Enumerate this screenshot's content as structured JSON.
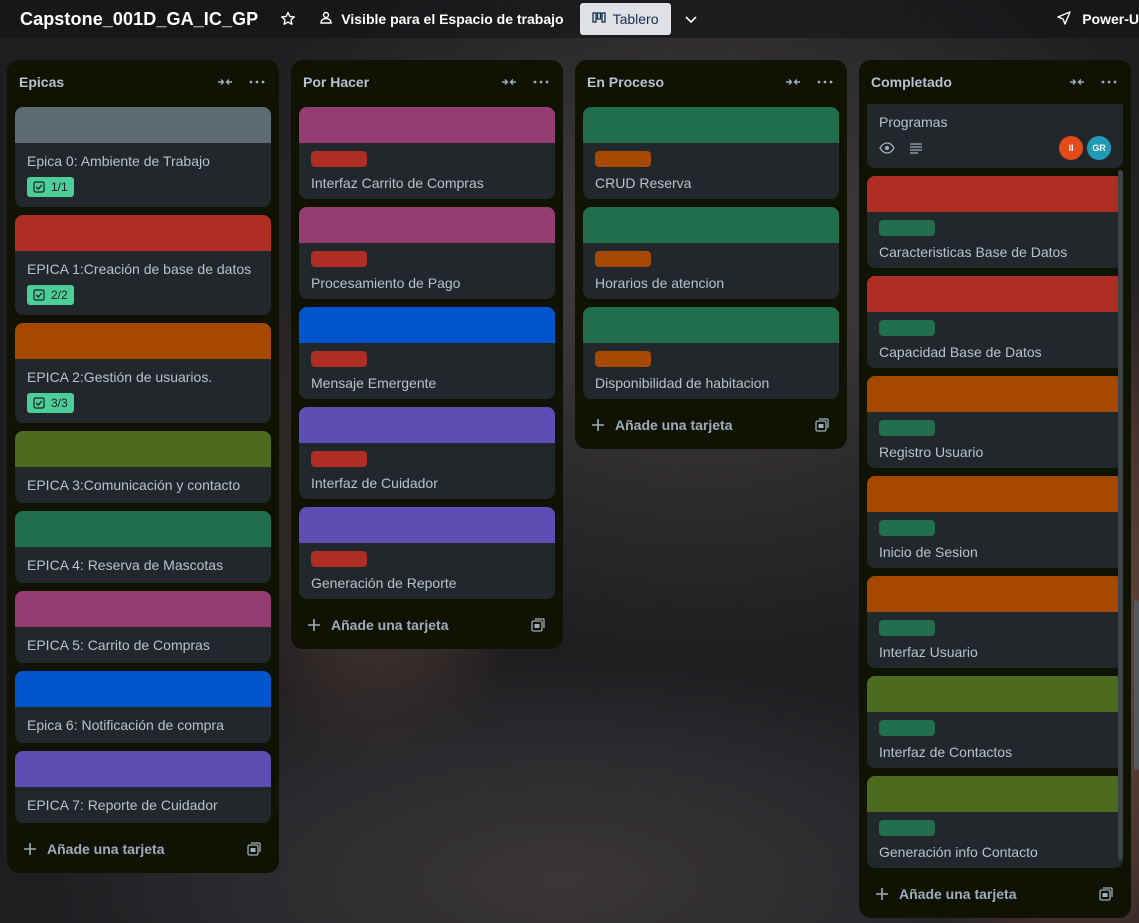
{
  "board": {
    "title": "Capstone_001D_GA_IC_GP",
    "visibility": "Visible para el Espacio de trabajo",
    "view": "Tablero",
    "powerups": "Power-U"
  },
  "colors": {
    "gray": "#5f6b73",
    "red": "#ae2e24",
    "orange": "#a54800",
    "olive": "#4c6b1f",
    "green": "#216e4e",
    "magenta": "#943d73",
    "blue": "#0055cc",
    "purple": "#5e4db2",
    "badge": "#4bce97",
    "avatar_ii": "#e34b1a",
    "avatar_gr": "#1f9bb8"
  },
  "add_card_label": "Añade una tarjeta",
  "lists": [
    {
      "title": "Epicas",
      "cards": [
        {
          "title": "Epica 0: Ambiente de Trabajo",
          "cover": "gray",
          "checklist": "1/1"
        },
        {
          "title": "EPICA 1:Creación de base de datos",
          "cover": "red",
          "checklist": "2/2"
        },
        {
          "title": "EPICA 2:Gestión de usuarios.",
          "cover": "orange",
          "checklist": "3/3"
        },
        {
          "title": "EPICA 3:Comunicación y contacto",
          "cover": "olive"
        },
        {
          "title": "EPICA 4: Reserva de Mascotas",
          "cover": "green"
        },
        {
          "title": "EPICA 5: Carrito de Compras",
          "cover": "magenta"
        },
        {
          "title": "Epica 6: Notificación de compra",
          "cover": "blue"
        },
        {
          "title": "EPICA 7: Reporte de Cuidador",
          "cover": "purple"
        }
      ]
    },
    {
      "title": "Por Hacer",
      "cards": [
        {
          "title": "Interfaz Carrito de Compras",
          "cover": "magenta",
          "label": "red"
        },
        {
          "title": "Procesamiento de Pago",
          "cover": "magenta",
          "label": "red"
        },
        {
          "title": "Mensaje Emergente",
          "cover": "blue",
          "label": "red"
        },
        {
          "title": "Interfaz de Cuidador",
          "cover": "purple",
          "label": "red"
        },
        {
          "title": "Generación de Reporte",
          "cover": "purple",
          "label": "red"
        }
      ]
    },
    {
      "title": "En Proceso",
      "cards": [
        {
          "title": "CRUD Reserva",
          "cover": "green",
          "label": "orange"
        },
        {
          "title": "Horarios de atencion",
          "cover": "green",
          "label": "orange"
        },
        {
          "title": "Disponibilidad de habitacion",
          "cover": "green",
          "label": "orange"
        }
      ]
    },
    {
      "title": "Completado",
      "cards": [
        {
          "title": "Programas",
          "label": "green",
          "members": [
            "II",
            "GR"
          ]
        },
        {
          "title": "Caracteristicas Base de Datos",
          "cover": "red",
          "label": "green"
        },
        {
          "title": "Capacidad Base de Datos",
          "cover": "red",
          "label": "green"
        },
        {
          "title": "Registro Usuario",
          "cover": "orange",
          "label": "green"
        },
        {
          "title": "Inicio de Sesion",
          "cover": "orange",
          "label": "green"
        },
        {
          "title": "Interfaz Usuario",
          "cover": "orange",
          "label": "green"
        },
        {
          "title": "Interfaz de Contactos",
          "cover": "olive",
          "label": "green"
        },
        {
          "title": "Generación info Contacto",
          "cover": "olive",
          "label": "green"
        }
      ]
    }
  ]
}
